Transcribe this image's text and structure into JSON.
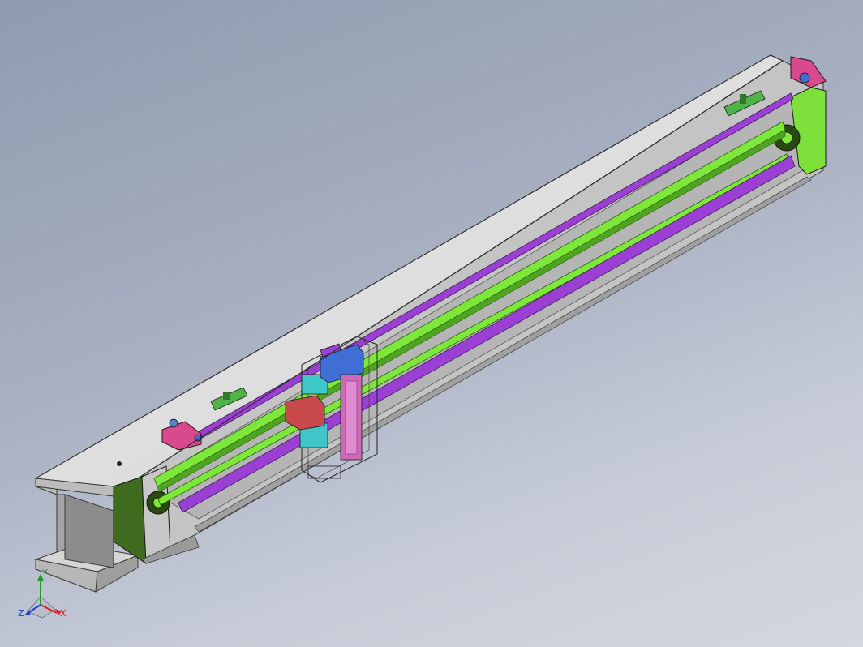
{
  "viewport": {
    "background_top": "#8f9bb0",
    "background_bottom": "#d3d7e0"
  },
  "model": {
    "housing_color": "#d9d9d9",
    "housing_shadow_color": "#9a9a9a",
    "end_plate_color": "#3f6b1e",
    "end_plate_face_color": "#7ee03a",
    "rail_green_color": "#7ee83a",
    "rail_purple_color": "#9c3fd4",
    "bracket_color": "#d94a8c",
    "carriage_cyan_color": "#3fc6c9",
    "carriage_red_color": "#c84a4a",
    "carriage_blue_color": "#3f6fd4",
    "slot_clip_color": "#4fb34a"
  },
  "triad": {
    "x_label": "X",
    "y_label": "Y",
    "z_label": "Z",
    "x_color": "#d62020",
    "y_color": "#1f9a2a",
    "z_color": "#1f3fd6"
  }
}
